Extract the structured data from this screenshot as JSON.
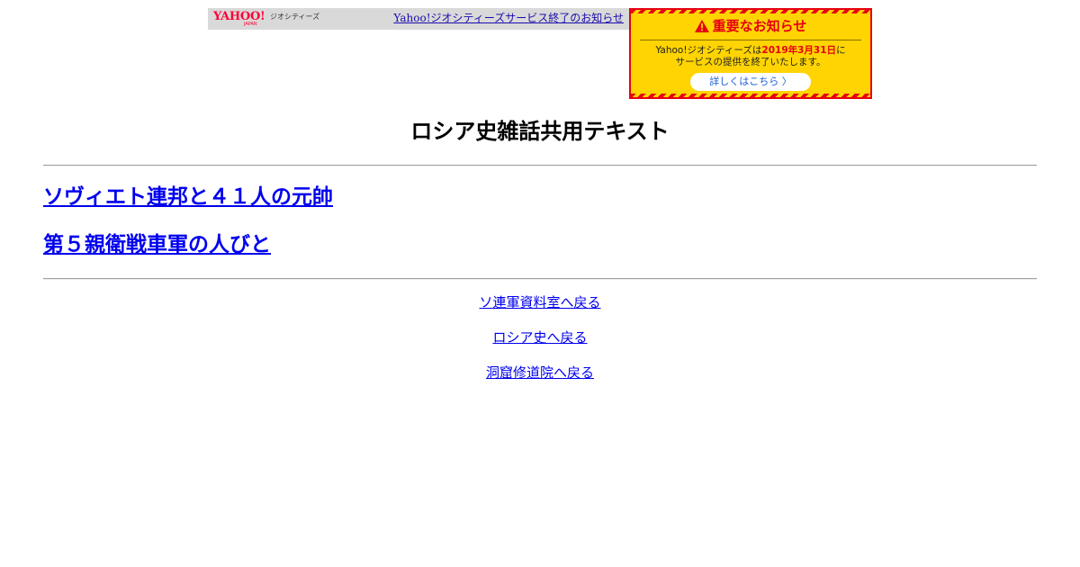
{
  "banner": {
    "logo_text": "YAHOO!",
    "logo_subtext": "JAPAN",
    "service_name": "ジオシティーズ",
    "notice_link": "Yahoo!ジオシティーズサービス終了のお知らせ",
    "notice_box": {
      "title": "重要なお知らせ",
      "body_line1_prefix": "Yahoo!ジオシティーズは",
      "body_line1_date": "2019年3月31日",
      "body_line1_suffix": "に",
      "body_line2": "サービスの提供を終了いたします。",
      "button_label": "詳しくはこちら 〉",
      "accent_color": "#e60012",
      "background_color": "#ffd400"
    }
  },
  "main": {
    "title": "ロシア史雑話共用テキスト",
    "links": [
      "ソヴィエト連邦と４１人の元帥",
      "第５親衛戦車軍の人びと"
    ],
    "back_links": [
      "ソ連軍資料室へ戻る",
      "ロシア史へ戻る",
      "洞窟修道院へ戻る"
    ]
  },
  "colors": {
    "link": "#0000ee"
  }
}
